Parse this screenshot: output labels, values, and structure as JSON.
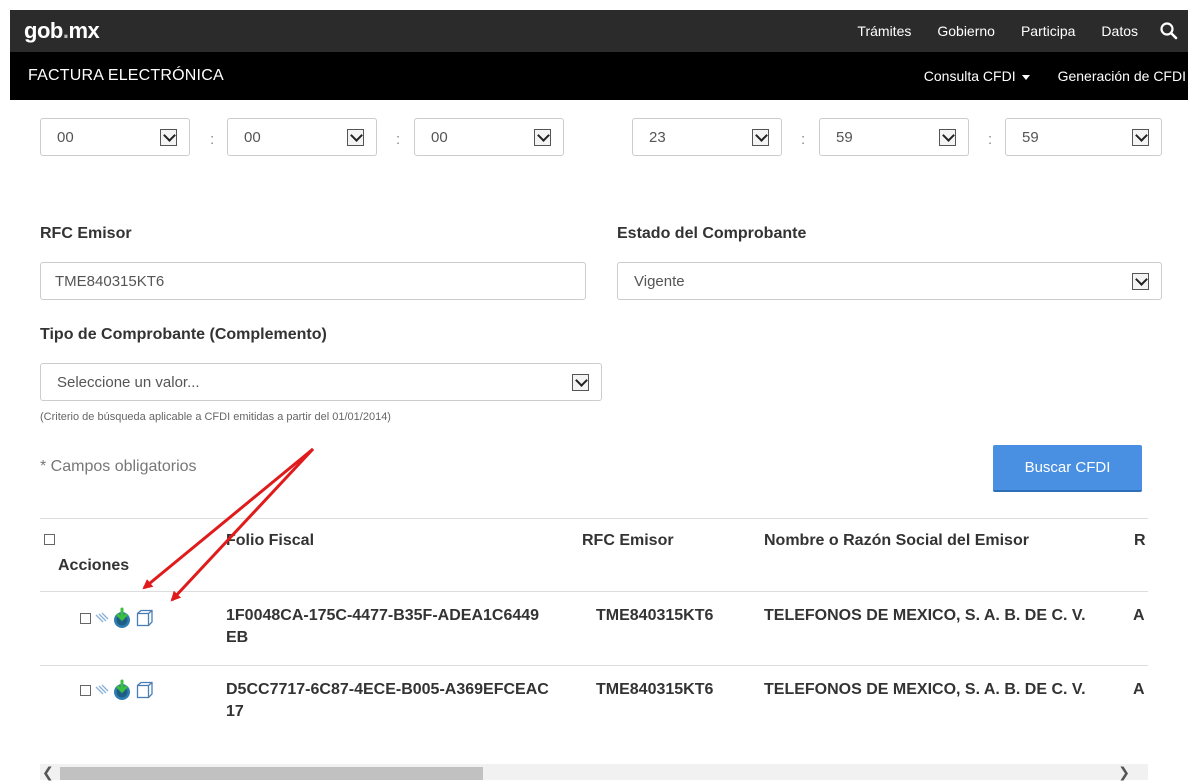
{
  "header": {
    "logo_main": "gob",
    "logo_dot": ".",
    "logo_tail": "mx",
    "nav": [
      "Trámites",
      "Gobierno",
      "Participa",
      "Datos"
    ]
  },
  "subheader": {
    "title": "FACTURA ELECTRÓNICA",
    "consulta": "Consulta CFDI",
    "generacion": "Generación de CFDI"
  },
  "time_start": {
    "h": "00",
    "m": "00",
    "s": "00"
  },
  "time_end": {
    "h": "23",
    "m": "59",
    "s": "59"
  },
  "separator": ":",
  "form": {
    "rfc_label": "RFC Emisor",
    "rfc_value": "TME840315KT6",
    "estado_label": "Estado del Comprobante",
    "estado_value": "Vigente",
    "tipo_label": "Tipo de Comprobante (Complemento)",
    "tipo_placeholder": "Seleccione un valor...",
    "hint": "(Criterio de búsqueda aplicable a CFDI emitidas a partir del 01/01/2014)",
    "required": "* Campos obligatorios",
    "search_button": "Buscar CFDI"
  },
  "table": {
    "headers": {
      "acciones": "Acciones",
      "folio": "Folio Fiscal",
      "rfc": "RFC Emisor",
      "nombre": "Nombre o Razón Social del Emisor",
      "next": "R"
    },
    "rows": [
      {
        "folio_1": "1F0048CA-175C-4477-B35F-ADEA1C6449",
        "folio_2": "EB",
        "rfc": "TME840315KT6",
        "nombre": "TELEFONOS DE MEXICO, S. A. B. DE C. V.",
        "next": "A"
      },
      {
        "folio_1": "D5CC7717-6C87-4ECE-B005-A369EFCEAC",
        "folio_2": "17",
        "rfc": "TME840315KT6",
        "nombre": "TELEFONOS DE MEXICO, S. A. B. DE C. V.",
        "next": "A"
      }
    ]
  },
  "colors": {
    "accent": "#4a90e2",
    "arrow": "#e01b1b",
    "topbar": "#2b2b2b"
  },
  "icons": [
    "search-icon",
    "chevron-down-icon",
    "checkbox-icon",
    "view-icon",
    "download-icon",
    "copy-icon",
    "arrow-left-icon",
    "arrow-right-icon"
  ]
}
